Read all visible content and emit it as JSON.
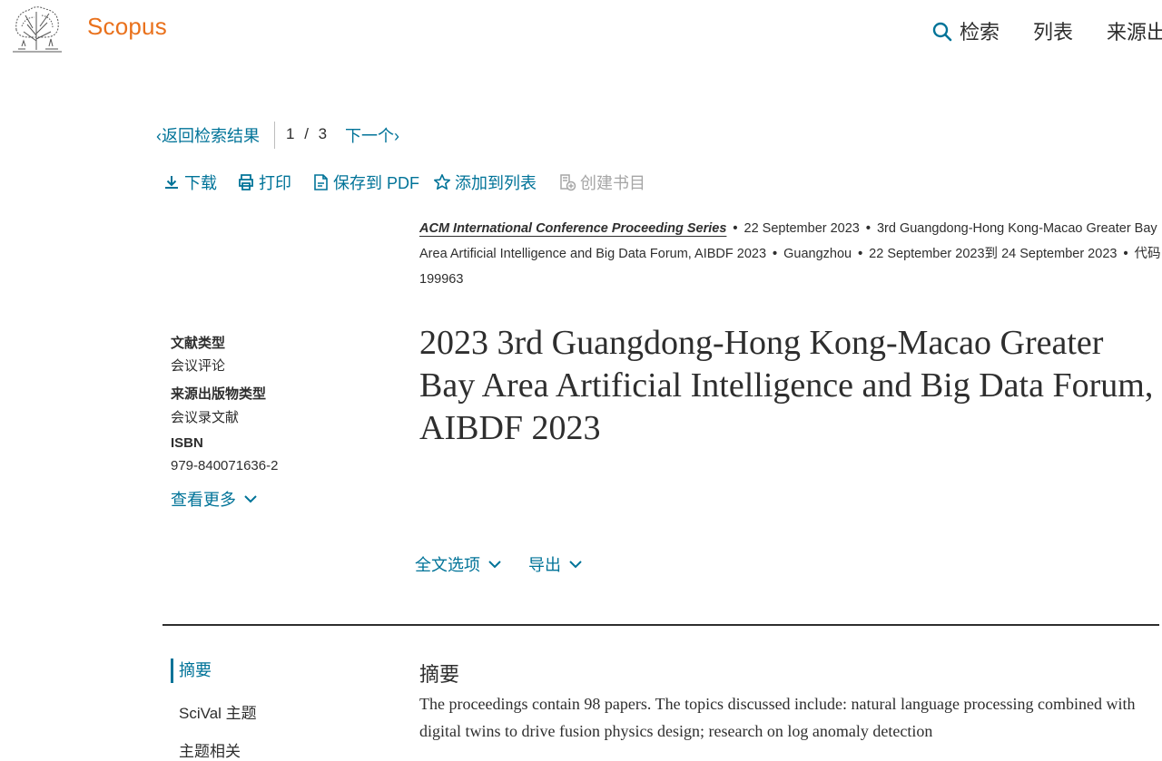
{
  "header": {
    "brand": "Scopus",
    "nav": {
      "search": "检索",
      "lists": "列表",
      "sources": "来源出"
    }
  },
  "nav_row": {
    "back": "返回检索结果",
    "pager_current": "1",
    "pager_sep": "/",
    "pager_total": "3",
    "next": "下一个"
  },
  "toolbar": {
    "download": "下载",
    "print": "打印",
    "save_pdf": "保存到 PDF",
    "add_to_list": "添加到列表",
    "create_bib": "创建书目"
  },
  "meta": {
    "series": "ACM International Conference Proceeding Series",
    "date": "22 September 2023",
    "conference": "3rd Guangdong-Hong Kong-Macao Greater Bay Area Artificial Intelligence and Big Data Forum, AIBDF 2023",
    "city": "Guangzhou",
    "period": "22 September 2023到 24 September 2023",
    "code": "代码 199963"
  },
  "details": {
    "doc_type_label": "文献类型",
    "doc_type_value": "会议评论",
    "source_type_label": "来源出版物类型",
    "source_type_value": "会议录文献",
    "isbn_label": "ISBN",
    "isbn_value": "979-840071636-2",
    "view_more": "查看更多"
  },
  "title": "2023 3rd Guangdong-Hong Kong-Macao Greater Bay Area Artificial Intelligence and Big Data Forum, AIBDF 2023",
  "options": {
    "full_text": "全文选项",
    "export": "导出"
  },
  "side_nav": {
    "abstract": "摘要",
    "scival": "SciVal 主题",
    "third": "主题相关"
  },
  "abstract": {
    "heading": "摘要",
    "text": "The proceedings contain 98 papers. The topics discussed include: natural language processing combined with digital twins to drive fusion physics design; research on log anomaly detection"
  },
  "colors": {
    "brand": "#e9711c",
    "link": "#007398",
    "text": "#2e2e2e",
    "disabled": "#a6a6a6"
  }
}
